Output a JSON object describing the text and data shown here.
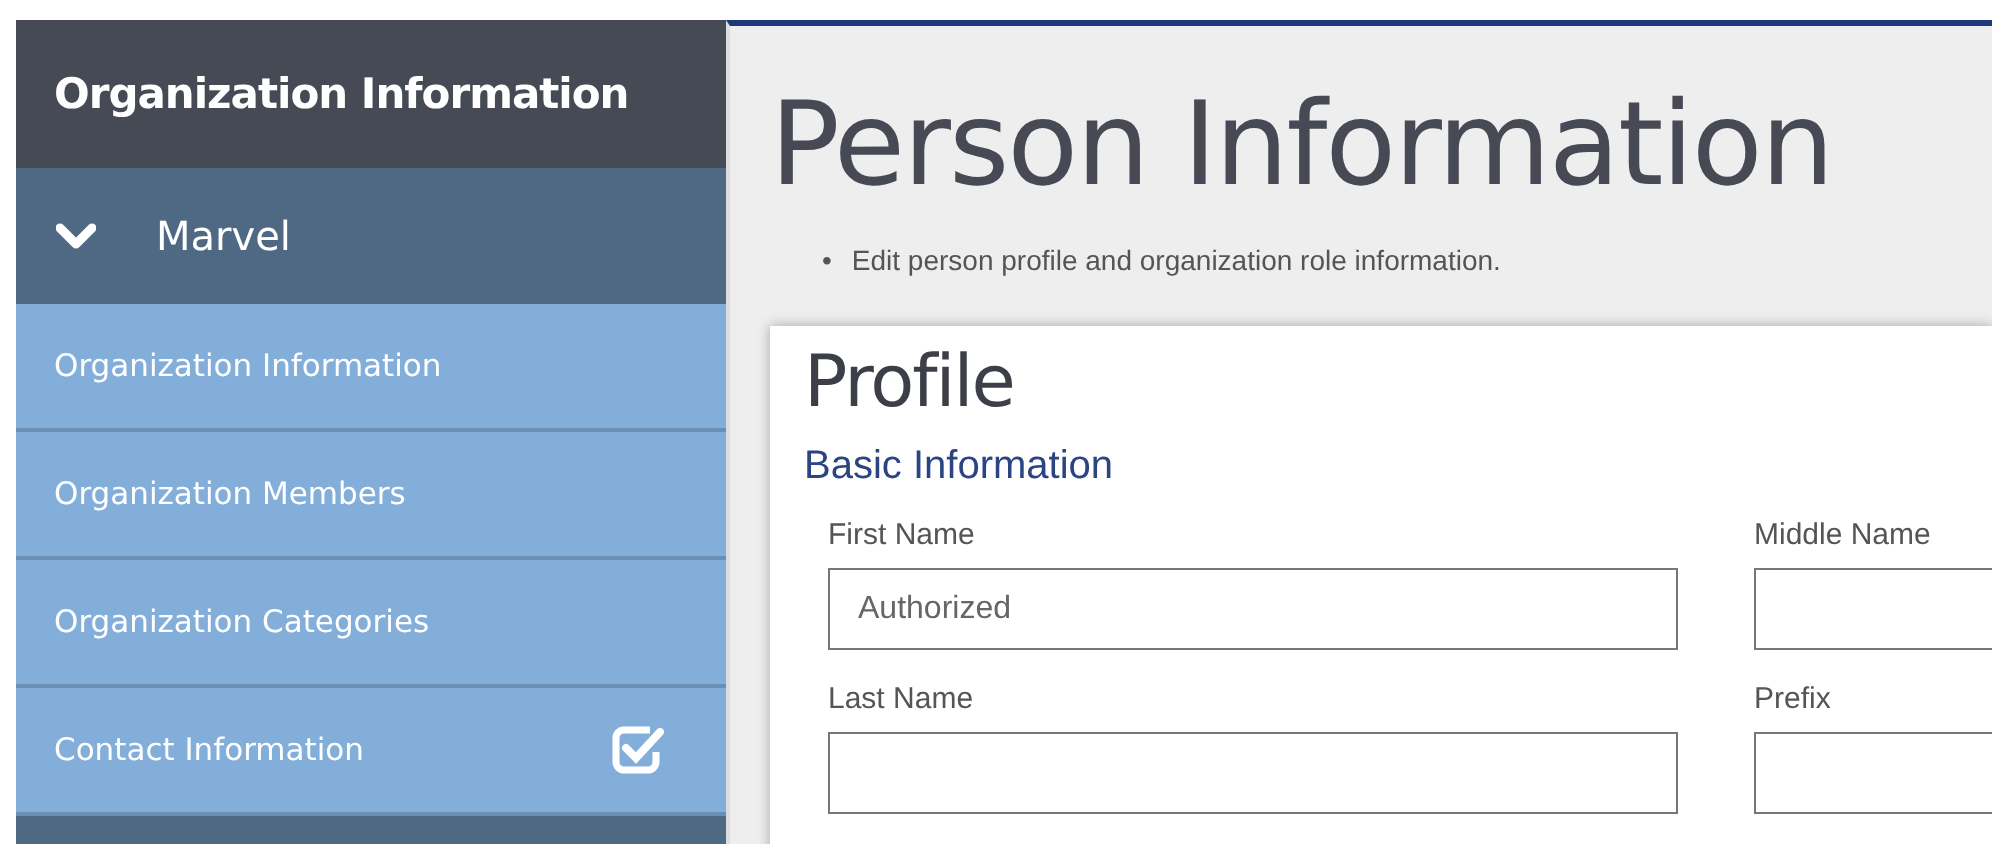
{
  "sidebar": {
    "title": "Organization Information",
    "group": {
      "label": "Marvel",
      "expanded": true
    },
    "items": [
      {
        "label": "Organization Information",
        "completed": false
      },
      {
        "label": "Organization Members",
        "completed": false
      },
      {
        "label": "Organization Categories",
        "completed": false
      },
      {
        "label": "Contact Information",
        "completed": true
      }
    ]
  },
  "page": {
    "title": "Person Information",
    "notes": [
      {
        "bullet": "•",
        "text": "Edit person profile and organization role information."
      }
    ]
  },
  "card": {
    "title": "Profile",
    "section": "Basic Information",
    "fields": [
      {
        "label": "First Name",
        "value": "Authorized"
      },
      {
        "label": "Middle Name"
      },
      {
        "label": "Last Name"
      },
      {
        "label": "Prefix"
      }
    ]
  }
}
